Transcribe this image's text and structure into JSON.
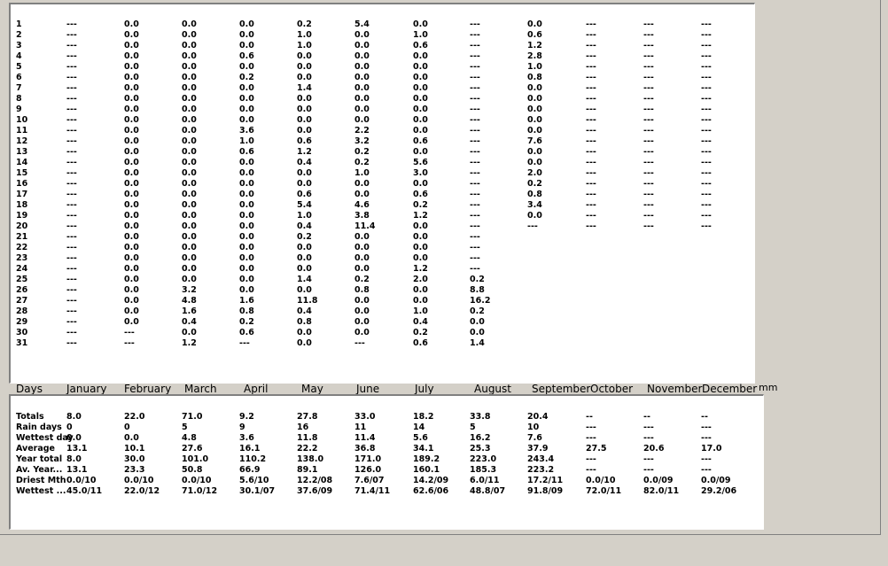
{
  "unit_label": "mm",
  "headers": [
    "Days",
    "January",
    "February",
    "March",
    "April",
    "May",
    "June",
    "July",
    "August",
    "September",
    "October",
    "November",
    "December"
  ],
  "daily_rows": [
    [
      "1",
      "---",
      "0.0",
      "0.0",
      "0.0",
      "0.2",
      "5.4",
      "0.0",
      "---",
      "0.0",
      "---",
      "---",
      "---"
    ],
    [
      "2",
      "---",
      "0.0",
      "0.0",
      "0.0",
      "1.0",
      "0.0",
      "1.0",
      "---",
      "0.6",
      "---",
      "---",
      "---"
    ],
    [
      "3",
      "---",
      "0.0",
      "0.0",
      "0.0",
      "1.0",
      "0.0",
      "0.6",
      "---",
      "1.2",
      "---",
      "---",
      "---"
    ],
    [
      "4",
      "---",
      "0.0",
      "0.0",
      "0.6",
      "0.0",
      "0.0",
      "0.0",
      "---",
      "2.8",
      "---",
      "---",
      "---"
    ],
    [
      "5",
      "---",
      "0.0",
      "0.0",
      "0.0",
      "0.0",
      "0.0",
      "0.0",
      "---",
      "1.0",
      "---",
      "---",
      "---"
    ],
    [
      "6",
      "---",
      "0.0",
      "0.0",
      "0.2",
      "0.0",
      "0.0",
      "0.0",
      "---",
      "0.8",
      "---",
      "---",
      "---"
    ],
    [
      "7",
      "---",
      "0.0",
      "0.0",
      "0.0",
      "1.4",
      "0.0",
      "0.0",
      "---",
      "0.0",
      "---",
      "---",
      "---"
    ],
    [
      "8",
      "---",
      "0.0",
      "0.0",
      "0.0",
      "0.0",
      "0.0",
      "0.0",
      "---",
      "0.0",
      "---",
      "---",
      "---"
    ],
    [
      "9",
      "---",
      "0.0",
      "0.0",
      "0.0",
      "0.0",
      "0.0",
      "0.0",
      "---",
      "0.0",
      "---",
      "---",
      "---"
    ],
    [
      "10",
      "---",
      "0.0",
      "0.0",
      "0.0",
      "0.0",
      "0.0",
      "0.0",
      "---",
      "0.0",
      "---",
      "---",
      "---"
    ],
    [
      "11",
      "---",
      "0.0",
      "0.0",
      "3.6",
      "0.0",
      "2.2",
      "0.0",
      "---",
      "0.0",
      "---",
      "---",
      "---"
    ],
    [
      "12",
      "---",
      "0.0",
      "0.0",
      "1.0",
      "0.6",
      "3.2",
      "0.6",
      "---",
      "7.6",
      "---",
      "---",
      "---"
    ],
    [
      "13",
      "---",
      "0.0",
      "0.0",
      "0.6",
      "1.2",
      "0.2",
      "0.0",
      "---",
      "0.0",
      "---",
      "---",
      "---"
    ],
    [
      "14",
      "---",
      "0.0",
      "0.0",
      "0.0",
      "0.4",
      "0.2",
      "5.6",
      "---",
      "0.0",
      "---",
      "---",
      "---"
    ],
    [
      "15",
      "---",
      "0.0",
      "0.0",
      "0.0",
      "0.0",
      "1.0",
      "3.0",
      "---",
      "2.0",
      "---",
      "---",
      "---"
    ],
    [
      "16",
      "---",
      "0.0",
      "0.0",
      "0.0",
      "0.0",
      "0.0",
      "0.0",
      "---",
      "0.2",
      "---",
      "---",
      "---"
    ],
    [
      "17",
      "---",
      "0.0",
      "0.0",
      "0.0",
      "0.6",
      "0.0",
      "0.6",
      "---",
      "0.8",
      "---",
      "---",
      "---"
    ],
    [
      "18",
      "---",
      "0.0",
      "0.0",
      "0.0",
      "5.4",
      "4.6",
      "0.2",
      "---",
      "3.4",
      "---",
      "---",
      "---"
    ],
    [
      "19",
      "---",
      "0.0",
      "0.0",
      "0.0",
      "1.0",
      "3.8",
      "1.2",
      "---",
      "0.0",
      "---",
      "---",
      "---"
    ],
    [
      "20",
      "---",
      "0.0",
      "0.0",
      "0.0",
      "0.4",
      "11.4",
      "0.0",
      "---",
      "---",
      "---",
      "---",
      "---"
    ],
    [
      "21",
      "---",
      "0.0",
      "0.0",
      "0.0",
      "0.2",
      "0.0",
      "0.0",
      "---",
      "",
      "",
      "",
      ""
    ],
    [
      "22",
      "---",
      "0.0",
      "0.0",
      "0.0",
      "0.0",
      "0.0",
      "0.0",
      "---",
      "",
      "",
      "",
      ""
    ],
    [
      "23",
      "---",
      "0.0",
      "0.0",
      "0.0",
      "0.0",
      "0.0",
      "0.0",
      "---",
      "",
      "",
      "",
      ""
    ],
    [
      "24",
      "---",
      "0.0",
      "0.0",
      "0.0",
      "0.0",
      "0.0",
      "1.2",
      "---",
      "",
      "",
      "",
      ""
    ],
    [
      "25",
      "---",
      "0.0",
      "0.0",
      "0.0",
      "1.4",
      "0.2",
      "2.0",
      "0.2",
      "",
      "",
      "",
      ""
    ],
    [
      "26",
      "---",
      "0.0",
      "3.2",
      "0.0",
      "0.0",
      "0.8",
      "0.0",
      "8.8",
      "",
      "",
      "",
      ""
    ],
    [
      "27",
      "---",
      "0.0",
      "4.8",
      "1.6",
      "11.8",
      "0.0",
      "0.0",
      "16.2",
      "",
      "",
      "",
      ""
    ],
    [
      "28",
      "---",
      "0.0",
      "1.6",
      "0.8",
      "0.4",
      "0.0",
      "1.0",
      "0.2",
      "",
      "",
      "",
      ""
    ],
    [
      "29",
      "---",
      "0.0",
      "0.4",
      "0.2",
      "0.8",
      "0.0",
      "0.4",
      "0.0",
      "",
      "",
      "",
      ""
    ],
    [
      "30",
      "---",
      "---",
      "0.0",
      "0.6",
      "0.0",
      "0.0",
      "0.2",
      "0.0",
      "",
      "",
      "",
      ""
    ],
    [
      "31",
      "---",
      "---",
      "1.2",
      "---",
      "0.0",
      "---",
      "0.6",
      "1.4",
      "",
      "",
      "",
      ""
    ]
  ],
  "summary_rows": [
    [
      "Totals",
      "8.0",
      "22.0",
      "71.0",
      "9.2",
      "27.8",
      "33.0",
      "18.2",
      "33.8",
      "20.4",
      "--",
      "--",
      "--"
    ],
    [
      "Rain days",
      "0",
      "0",
      "5",
      "9",
      "16",
      "11",
      "14",
      "5",
      "10",
      "---",
      "---",
      "---"
    ],
    [
      "Wettest day",
      "0.0",
      "0.0",
      "4.8",
      "3.6",
      "11.8",
      "11.4",
      "5.6",
      "16.2",
      "7.6",
      "---",
      "---",
      "---"
    ],
    [
      "Average",
      "13.1",
      "10.1",
      "27.6",
      "16.1",
      "22.2",
      "36.8",
      "34.1",
      "25.3",
      "37.9",
      "27.5",
      "20.6",
      "17.0"
    ],
    [
      "Year total",
      "8.0",
      "30.0",
      "101.0",
      "110.2",
      "138.0",
      "171.0",
      "189.2",
      "223.0",
      "243.4",
      "---",
      "---",
      "---"
    ],
    [
      "Av. Year...",
      "13.1",
      "23.3",
      "50.8",
      "66.9",
      "89.1",
      "126.0",
      "160.1",
      "185.3",
      "223.2",
      "---",
      "---",
      "---"
    ],
    [
      "Driest Mth",
      "0.0/10",
      "0.0/10",
      "0.0/10",
      "5.6/10",
      "12.2/08",
      "7.6/07",
      "14.2/09",
      "6.0/11",
      "17.2/11",
      "0.0/10",
      "0.0/09",
      "0.0/09"
    ],
    [
      "Wettest ...",
      "45.0/11",
      "22.0/12",
      "71.0/12",
      "30.1/07",
      "37.6/09",
      "71.4/11",
      "62.6/06",
      "48.8/07",
      "91.8/09",
      "72.0/11",
      "82.0/11",
      "29.2/06"
    ]
  ]
}
